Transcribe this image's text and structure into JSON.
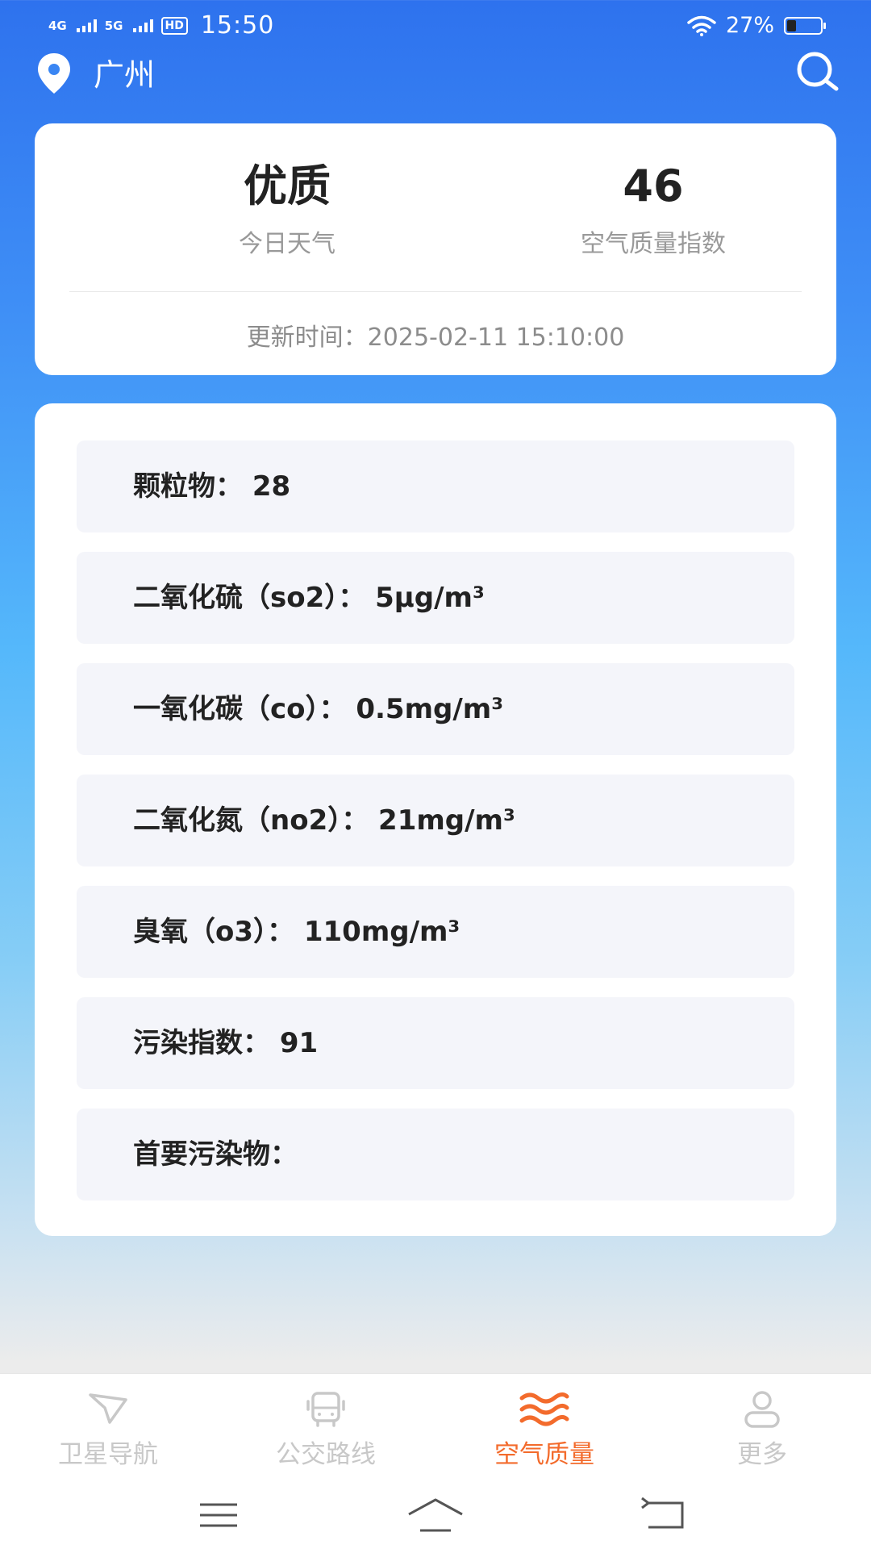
{
  "status_bar": {
    "net1": "4G",
    "net2": "5G",
    "hd": "HD",
    "time": "15:50",
    "battery_text": "27%",
    "battery_level": 0.27
  },
  "header": {
    "city": "广州"
  },
  "summary": {
    "quality_value": "优质",
    "quality_label": "今日天气",
    "aqi_value": "46",
    "aqi_label": "空气质量指数",
    "update_time": "更新时间：2025-02-11 15:10:00"
  },
  "details": {
    "items": [
      {
        "text": "颗粒物： 28"
      },
      {
        "text": "二氧化硫（so2）： 5μg/m³"
      },
      {
        "text": "一氧化碳（co）： 0.5mg/m³"
      },
      {
        "text": "二氧化氮（no2）： 21mg/m³"
      },
      {
        "text": "臭氧（o3）： 110mg/m³"
      },
      {
        "text": "污染指数： 91"
      },
      {
        "text": "首要污染物："
      }
    ]
  },
  "nav": {
    "tabs": [
      {
        "label": "卫星导航",
        "icon": "navigation-arrow-icon"
      },
      {
        "label": "公交路线",
        "icon": "bus-icon"
      },
      {
        "label": "空气质量",
        "icon": "air-waves-icon",
        "active": true
      },
      {
        "label": "更多",
        "icon": "user-icon"
      }
    ],
    "active_color": "#f36b2c",
    "inactive_color": "#c8c8c8"
  },
  "colors": {
    "gradient_top": "#2e72ee",
    "gradient_mid": "#55b8fb",
    "page_bottom": "#ececec"
  }
}
